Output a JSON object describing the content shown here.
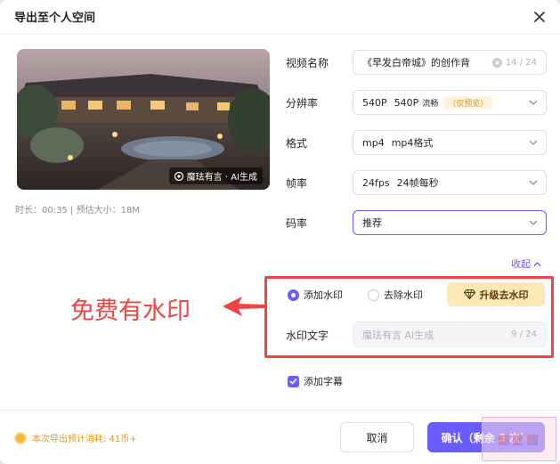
{
  "dialog": {
    "title": "导出至个人空间"
  },
  "preview": {
    "watermark_text": "魔珐有言 · AI生成",
    "duration_label": "时长：",
    "duration": "00:35",
    "size_label": "预估大小：",
    "size": "18M"
  },
  "form": {
    "name": {
      "label": "视频名称",
      "value": "《早发白帝城》的创作背",
      "count": "14 / 24"
    },
    "resolution": {
      "label": "分辨率",
      "v1": "540P",
      "v2": "540P",
      "quality": "流畅",
      "tag": "（仅预览）"
    },
    "format": {
      "label": "格式",
      "v1": "mp4",
      "v2": "mp4格式"
    },
    "fps": {
      "label": "帧率",
      "v1": "24fps",
      "v2": "24帧每秒"
    },
    "bitrate": {
      "label": "码率",
      "value": "推荐"
    },
    "collapse_label": "收起"
  },
  "watermark": {
    "add_label": "添加水印",
    "remove_label": "去除水印",
    "upgrade_label": "升级去水印",
    "text_label": "水印文字",
    "placeholder": "魔珐有言 AI生成",
    "count": "9 / 24",
    "selected": "add"
  },
  "subtitle": {
    "label": "添加字幕",
    "checked": true
  },
  "annotation": {
    "text": "免费有水印"
  },
  "footer": {
    "cost_text": "本次导出预计消耗: 41币+",
    "cancel_label": "取消",
    "confirm_label": "确认（剩余 3 次）"
  },
  "colors": {
    "accent": "#6a5cff",
    "annotation": "#ef4444",
    "coin": "#f6b73c"
  }
}
